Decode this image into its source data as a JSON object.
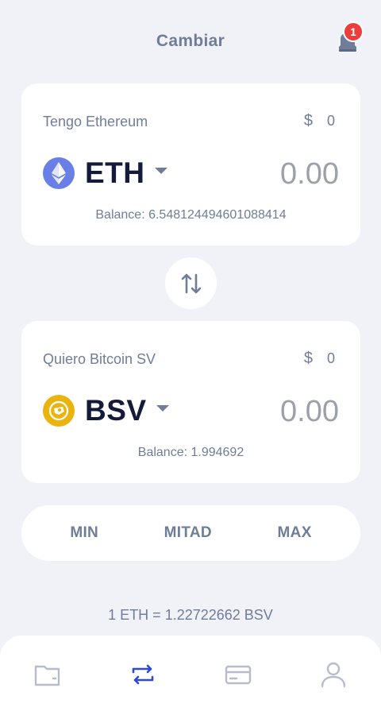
{
  "header": {
    "title": "Cambiar",
    "notification_count": "1"
  },
  "from": {
    "label": "Tengo Ethereum",
    "usd_symbol": "$",
    "usd_value": "0",
    "ticker": "ETH",
    "amount_placeholder": "0.00",
    "balance": "Balance: 6.548124494601088414",
    "icon": "ethereum-icon",
    "icon_color": "#6a7fe6"
  },
  "to": {
    "label": "Quiero Bitcoin SV",
    "usd_symbol": "$",
    "usd_value": "0",
    "ticker": "BSV",
    "amount_placeholder": "0.00",
    "balance": "Balance: 1.994692",
    "icon": "bitcoin-sv-icon",
    "icon_color": "#eab30e"
  },
  "quick": {
    "min": "MIN",
    "half": "MITAD",
    "max": "MAX"
  },
  "rate": "1 ETH = 1.22722662 BSV",
  "tabs": [
    {
      "icon": "wallet-icon",
      "active": false
    },
    {
      "icon": "exchange-icon",
      "active": true
    },
    {
      "icon": "card-icon",
      "active": false
    },
    {
      "icon": "profile-icon",
      "active": false
    }
  ],
  "colors": {
    "accent": "#2e49d8",
    "muted": "#6f7d99",
    "badge": "#ee3b3b",
    "background": "#f1f2f7"
  }
}
